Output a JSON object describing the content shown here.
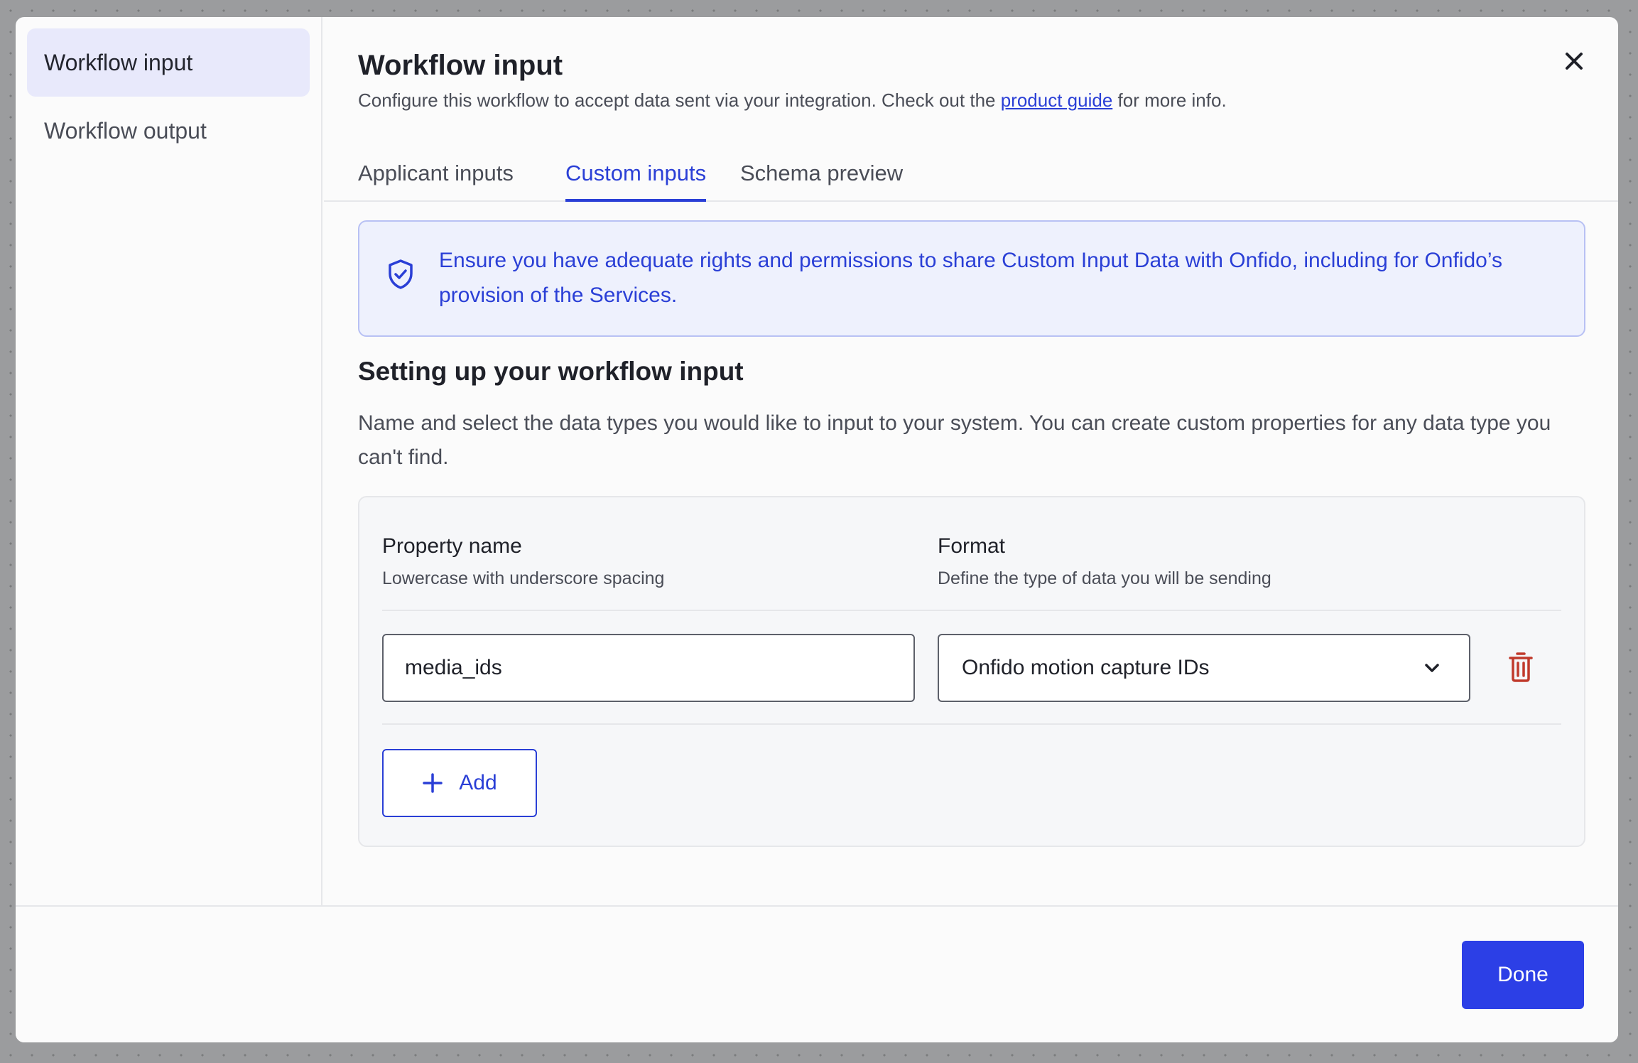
{
  "sidebar": {
    "items": [
      {
        "label": "Workflow input",
        "active": true
      },
      {
        "label": "Workflow output",
        "active": false
      }
    ]
  },
  "header": {
    "title": "Workflow input",
    "subtitle_before": "Configure this workflow to accept data sent via your integration. Check out the ",
    "subtitle_link": "product guide",
    "subtitle_after": " for more info."
  },
  "tabs": [
    {
      "label": "Applicant inputs",
      "active": false
    },
    {
      "label": "Custom inputs",
      "active": true
    },
    {
      "label": "Schema preview",
      "active": false
    }
  ],
  "notice": {
    "icon": "shield-check-icon",
    "text": "Ensure you have adequate rights and permissions to share Custom Input Data with Onfido, including for Onfido’s provision of the Services."
  },
  "section": {
    "heading": "Setting up your workflow input",
    "description": "Name and select the data types you would like to input to your system. You can create custom properties for any data type you can't find."
  },
  "table": {
    "columns": [
      {
        "title": "Property name",
        "hint": "Lowercase with underscore spacing"
      },
      {
        "title": "Format",
        "hint": "Define the type of data you will be sending"
      }
    ],
    "rows": [
      {
        "property_name": "media_ids",
        "format": "Onfido motion capture IDs"
      }
    ],
    "add_label": "Add"
  },
  "footer": {
    "done_label": "Done"
  },
  "colors": {
    "accent": "#2a3fd6",
    "primary_button": "#2c3fe6",
    "danger": "#c0392b",
    "notice_bg": "#eef1fd"
  }
}
